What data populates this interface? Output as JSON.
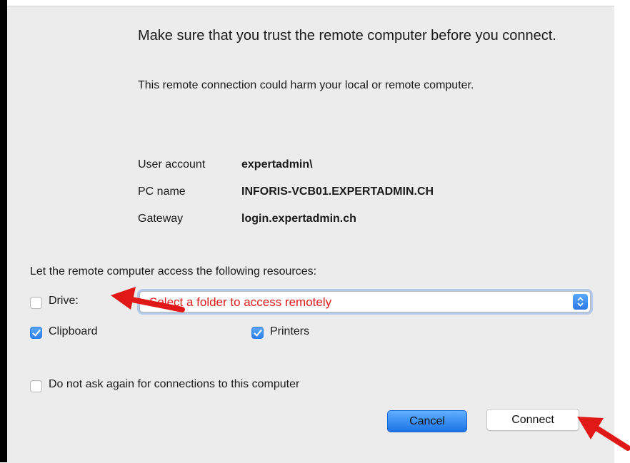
{
  "dialog": {
    "title": "Make sure that you trust the remote computer before you connect.",
    "subtitle": "This remote connection could harm your local or remote computer."
  },
  "info": {
    "user_account_label": "User account",
    "user_account_value": "expertadmin\\",
    "pc_name_label": "PC name",
    "pc_name_value": "INFORIS-VCB01.EXPERTADMIN.CH",
    "gateway_label": "Gateway",
    "gateway_value": "login.expertadmin.ch"
  },
  "resources": {
    "heading": "Let the remote computer access the following resources:",
    "drive_label": "Drive:",
    "drive_checked": false,
    "drive_folder_select": "Select a folder to access remotely",
    "clipboard_label": "Clipboard",
    "clipboard_checked": true,
    "printers_label": "Printers",
    "printers_checked": true
  },
  "do_not_ask": {
    "label": "Do not ask again for connections to this computer",
    "checked": false
  },
  "buttons": {
    "cancel": "Cancel",
    "connect": "Connect"
  },
  "colors": {
    "annotation_arrow": "#e01818",
    "accent_blue": "#2f7fe8",
    "placeholder_red": "#e01818"
  }
}
